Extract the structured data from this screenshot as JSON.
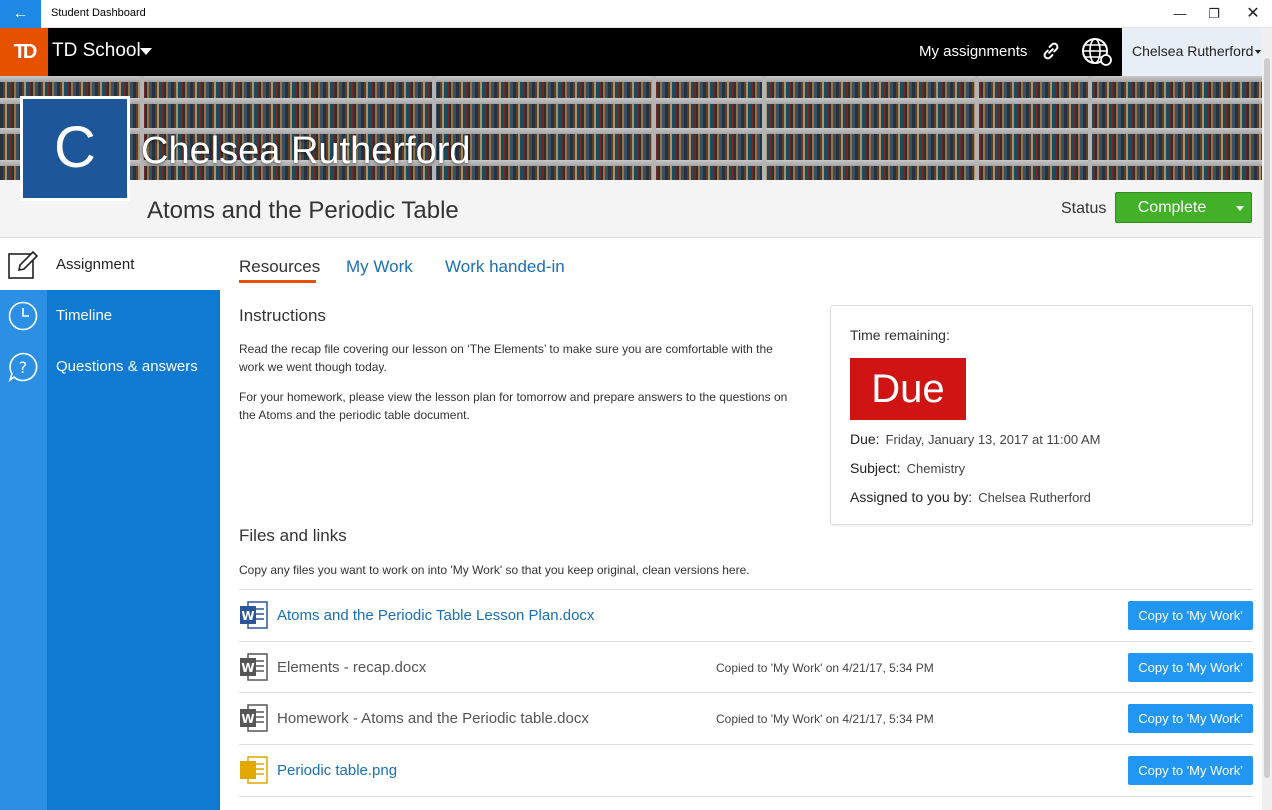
{
  "window": {
    "title": "Student Dashboard",
    "back_icon": "back-arrow-icon",
    "min_glyph": "—",
    "max_glyph": "❐",
    "close_glyph": "✕"
  },
  "header": {
    "logo_text": "TD",
    "school_name": "TD School",
    "my_assignments": "My assignments",
    "user_name": "Chelsea Rutherford"
  },
  "profile": {
    "initial": "C",
    "name": "Chelsea Rutherford"
  },
  "assignment": {
    "title": "Atoms and the Periodic Table",
    "status_label": "Status",
    "status_value": "Complete"
  },
  "sidebar": {
    "items": [
      {
        "label": "Assignment",
        "icon": "edit-icon"
      },
      {
        "label": "Timeline",
        "icon": "clock-icon"
      },
      {
        "label": "Questions & answers",
        "icon": "question-icon"
      }
    ]
  },
  "tabs": [
    {
      "label": "Resources"
    },
    {
      "label": "My Work"
    },
    {
      "label": "Work handed-in"
    }
  ],
  "instructions": {
    "heading": "Instructions",
    "paragraph1": "Read the recap file covering our lesson on ‘The Elements’ to make sure you are comfortable with the work we went though today.",
    "paragraph2": "For your homework, please view the lesson plan for tomorrow and prepare answers to the questions on the Atoms and the periodic table document."
  },
  "time_card": {
    "time_label": "Time remaining:",
    "due_badge": "Due",
    "due_key": "Due:",
    "due_value": "Friday, January 13, 2017 at 11:00 AM",
    "subject_key": "Subject:",
    "subject_value": "Chemistry",
    "assigned_key": "Assigned to you by:",
    "assigned_value": "Chelsea Rutherford"
  },
  "files": {
    "heading": "Files and links",
    "note": "Copy any files you want to work on into 'My Work' so that you keep original, clean versions here.",
    "items": [
      {
        "name": "Atoms and the Periodic Table Lesson Plan.docx",
        "copied": "",
        "button": "Copy to 'My Work'",
        "icon": "word-doc-icon"
      },
      {
        "name": "Elements - recap.docx",
        "copied": "Copied to 'My Work' on 4/21/17, 5:34 PM",
        "button": "Copy to 'My Work'",
        "icon": "word-doc-icon"
      },
      {
        "name": "Homework - Atoms and the Periodic table.docx",
        "copied": "Copied to 'My Work' on 4/21/17, 5:34 PM",
        "button": "Copy to 'My Work'",
        "icon": "word-doc-icon"
      },
      {
        "name": "Periodic table.png",
        "copied": "",
        "button": "Copy to 'My Work'",
        "icon": "image-file-icon"
      }
    ]
  },
  "colors": {
    "accent": "#e65100",
    "sidebar": "#0f7ad1",
    "status_green": "#43b02a",
    "due_red": "#d01414",
    "link_blue": "#1a6fb8"
  }
}
